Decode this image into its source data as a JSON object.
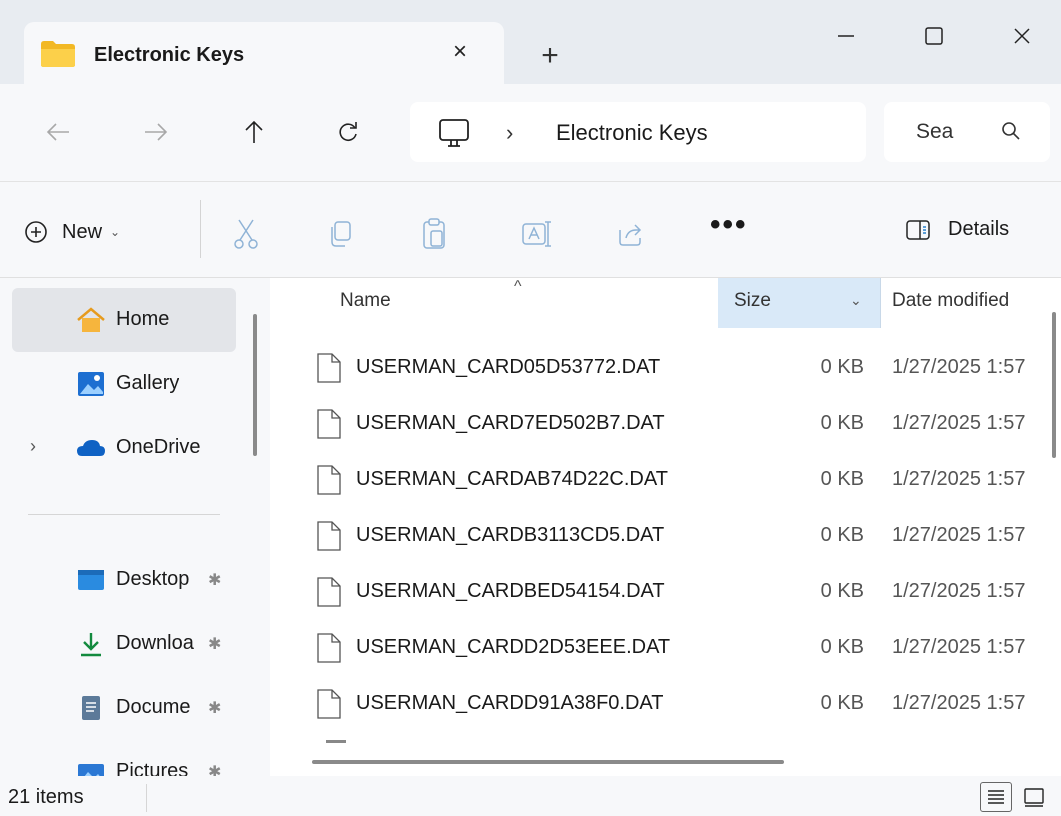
{
  "window": {
    "tab_title": "Electronic Keys",
    "tab_close": "×",
    "new_tab": "+"
  },
  "navigation": {
    "back_icon": "arrow-left-icon",
    "forward_icon": "arrow-right-icon",
    "up_icon": "arrow-up-icon",
    "refresh_icon": "refresh-icon",
    "breadcrumb_separator": "›",
    "breadcrumb_current": "Electronic Keys",
    "search_placeholder": "Sea"
  },
  "command_bar": {
    "new_label": "New",
    "new_chevron": "⌄",
    "more_label": "•••",
    "details_label": "Details",
    "disabled_color": "#a0b6cc"
  },
  "sidebar": {
    "items": [
      {
        "label": "Home",
        "icon": "home-icon",
        "selected": true
      },
      {
        "label": "Gallery",
        "icon": "gallery-icon"
      },
      {
        "label": "OneDrive",
        "icon": "cloud-icon",
        "expander": "›"
      },
      {
        "label": "Desktop",
        "icon": "desktop-icon",
        "pin": "📌"
      },
      {
        "label": "Downloa",
        "icon": "download-icon",
        "pin": "📌"
      },
      {
        "label": "Docume",
        "icon": "document-icon",
        "pin": "📌"
      },
      {
        "label": "Pictures",
        "icon": "pictures-icon",
        "pin": "📌"
      }
    ]
  },
  "file_list": {
    "columns": {
      "name": "Name",
      "size": "Size",
      "date": "Date modified",
      "sort_caret": "^",
      "size_chevron": "⌄"
    },
    "rows": [
      {
        "name": "USERMAN_CARD05D53772.DAT",
        "size": "0 KB",
        "date": "1/27/2025 1:57"
      },
      {
        "name": "USERMAN_CARD7ED502B7.DAT",
        "size": "0 KB",
        "date": "1/27/2025 1:57"
      },
      {
        "name": "USERMAN_CARDAB74D22C.DAT",
        "size": "0 KB",
        "date": "1/27/2025 1:57"
      },
      {
        "name": "USERMAN_CARDB3113CD5.DAT",
        "size": "0 KB",
        "date": "1/27/2025 1:57"
      },
      {
        "name": "USERMAN_CARDBED54154.DAT",
        "size": "0 KB",
        "date": "1/27/2025 1:57"
      },
      {
        "name": "USERMAN_CARDD2D53EEE.DAT",
        "size": "0 KB",
        "date": "1/27/2025 1:57"
      },
      {
        "name": "USERMAN_CARDD91A38F0.DAT",
        "size": "0 KB",
        "date": "1/27/2025 1:57"
      }
    ]
  },
  "status_bar": {
    "item_count": "21 items"
  },
  "colors": {
    "accent": "#0067c0",
    "folder": "#f7c948",
    "header_highlight": "#d9e9f8"
  }
}
